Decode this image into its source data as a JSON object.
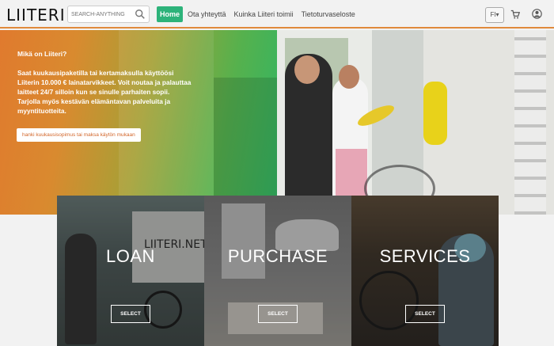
{
  "header": {
    "logo": "LIITERI",
    "search_placeholder": "SEARCH-ANYTHING",
    "nav": [
      {
        "label": "Home",
        "active": true
      },
      {
        "label": "Ota yhteyttä",
        "active": false
      },
      {
        "label": "Kuinka Liiteri toimii",
        "active": false
      },
      {
        "label": "Tietoturvaseloste",
        "active": false
      }
    ],
    "language": "FI▾",
    "icons": [
      "search-icon",
      "cart-icon",
      "user-icon"
    ],
    "accent_color": "#2db37a",
    "border_color": "#e08a3c"
  },
  "hero": {
    "heading": "Mikä on Liiteri?",
    "body": "Saat kuukausipaketilla tai kertamaksulla käyttöösi Liiterin 10.000 € lainatarvikkeet. Voit noutaa ja palauttaa laitteet 24/7 silloin kun se sinulle parhaiten sopii. Tarjolla myös kestävän elämäntavan palveluita ja myyntituotteita.",
    "cta": "hanki kuukausisopimus tai maksa käytön mukaan",
    "cta_color": "#d2662a"
  },
  "tiles": [
    {
      "title": "LOAN",
      "button": "SELECT",
      "sign": "LIITERI.NET"
    },
    {
      "title": "PURCHASE",
      "button": "SELECT"
    },
    {
      "title": "SERVICES",
      "button": "SELECT"
    }
  ]
}
